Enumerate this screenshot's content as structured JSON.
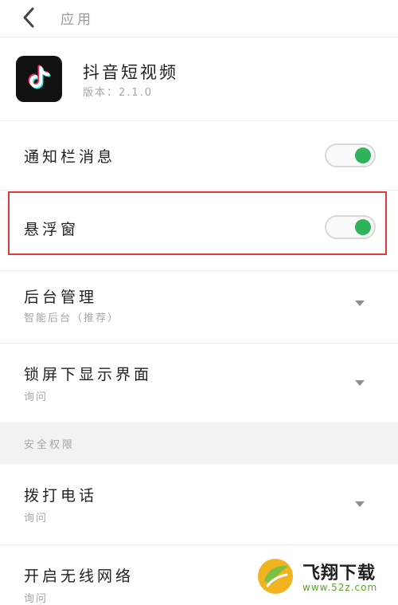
{
  "header": {
    "title": "应用"
  },
  "app": {
    "name": "抖音短视频",
    "version": "版本：2.1.0",
    "icon": "tiktok-logo"
  },
  "settings": {
    "notification": {
      "label": "通知栏消息",
      "enabled": true
    },
    "floating_window": {
      "label": "悬浮窗",
      "enabled": true
    },
    "background": {
      "label": "后台管理",
      "value": "智能后台（推荐）"
    },
    "lockscreen": {
      "label": "锁屏下显示界面",
      "value": "询问"
    }
  },
  "security": {
    "title": "安全权限",
    "phone_call": {
      "label": "拨打电话",
      "value": "询问"
    },
    "wireless": {
      "label": "开启无线网络",
      "value": "询问"
    }
  },
  "watermark": {
    "title": "飞翔下载",
    "url": "www.52z.com"
  },
  "colors": {
    "toggle_on": "#2fb35b",
    "highlight": "#e03a3a"
  }
}
